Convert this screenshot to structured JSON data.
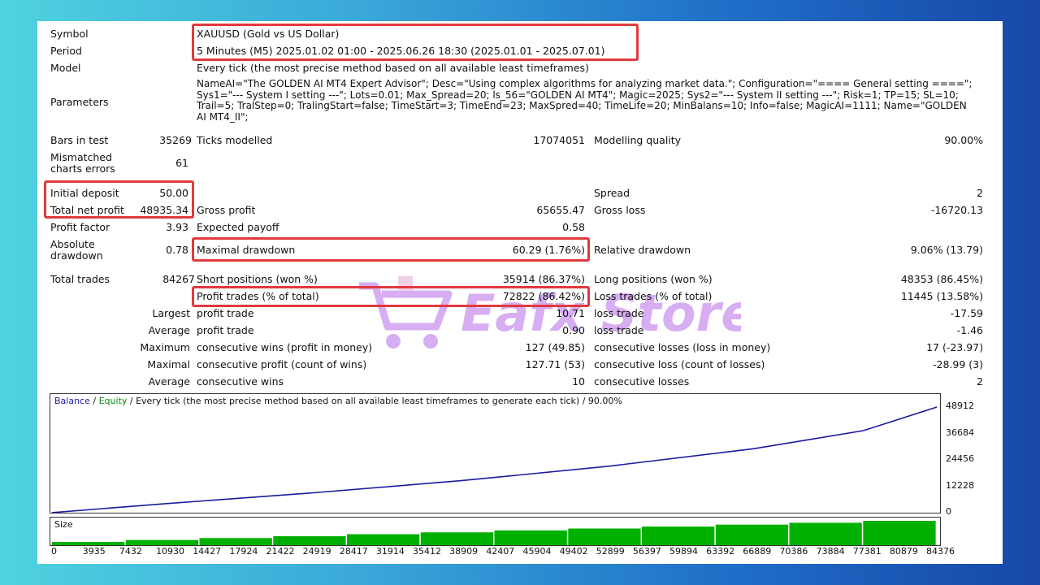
{
  "report": {
    "symbol_label": "Symbol",
    "symbol_value": "XAUUSD (Gold vs US Dollar)",
    "period_label": "Period",
    "period_value": "5 Minutes (M5) 2025.01.02 01:00 - 2025.06.26 18:30 (2025.01.01 - 2025.07.01)",
    "model_label": "Model",
    "model_value": "Every tick (the most precise method based on all available least timeframes)",
    "parameters_label": "Parameters",
    "parameters_value": "NameAI=\"The GOLDEN AI MT4 Expert Advisor\"; Desc=\"Using complex algorithms for analyzing market data.\"; Configuration=\"==== General setting ====\"; Sys1=\"--- System I setting ---\"; Lots=0.01; Max_Spread=20; ls_56=\"GOLDEN AI MT4\"; Magic=2025; Sys2=\"--- System II setting ---\"; Risk=1; TP=15; SL=10; Trail=5; TralStep=0; TralingStart=false; TimeStart=3; TimeEnd=23; MaxSpred=40; TimeLife=20; MinBalans=10; Info=false; MagicAI=1111; Name=\"GOLDEN AI MT4_II\";"
  },
  "stats": {
    "bars_label": "Bars in test",
    "bars_value": "35269",
    "ticks_label": "Ticks modelled",
    "ticks_value": "17074051",
    "quality_label": "Modelling quality",
    "quality_value": "90.00%",
    "mismatch_label": "Mismatched charts errors",
    "mismatch_value": "61",
    "initial_label": "Initial deposit",
    "initial_value": "50.00",
    "spread_label": "Spread",
    "spread_value": "2",
    "net_label": "Total net profit",
    "net_value": "48935.34",
    "gross_profit_label": "Gross profit",
    "gross_profit_value": "65655.47",
    "gross_loss_label": "Gross loss",
    "gross_loss_value": "-16720.13",
    "pf_label": "Profit factor",
    "pf_value": "3.93",
    "ep_label": "Expected payoff",
    "ep_value": "0.58",
    "abs_dd_label": "Absolute drawdown",
    "abs_dd_value": "0.78",
    "max_dd_label": "Maximal drawdown",
    "max_dd_value": "60.29 (1.76%)",
    "rel_dd_label": "Relative drawdown",
    "rel_dd_value": "9.06% (13.79)",
    "trades_label": "Total trades",
    "trades_value": "84267",
    "short_label": "Short positions (won %)",
    "short_value": "35914 (86.37%)",
    "long_label": "Long positions (won %)",
    "long_value": "48353 (86.45%)",
    "profit_trades_label": "Profit trades (% of total)",
    "profit_trades_value": "72822 (86.42%)",
    "loss_trades_label": "Loss trades (% of total)",
    "loss_trades_value": "11445 (13.58%)",
    "largest_label": "Largest",
    "largest_profit_label": "profit trade",
    "largest_profit_value": "10.71",
    "largest_loss_label": "loss trade",
    "largest_loss_value": "-17.59",
    "average_label": "Average",
    "average_profit_label": "profit trade",
    "average_profit_value": "0.90",
    "average_loss_label": "loss trade",
    "average_loss_value": "-1.46",
    "maximum_label": "Maximum",
    "max_wins_label": "consecutive wins (profit in money)",
    "max_wins_value": "127 (49.85)",
    "max_losses_label": "consecutive losses (loss in money)",
    "max_losses_value": "17 (-23.97)",
    "maximal_label": "Maximal",
    "maximal_profit_label": "consecutive profit (count of wins)",
    "maximal_profit_value": "127.71 (53)",
    "maximal_loss_label": "consecutive loss (count of losses)",
    "maximal_loss_value": "-28.99 (3)",
    "avg2_label": "Average",
    "avg_wins_label": "consecutive wins",
    "avg_wins_value": "10",
    "avg_losses_label": "consecutive losses",
    "avg_losses_value": "2"
  },
  "watermark": {
    "text": "Eafx Store",
    "text_color": "#b86de6"
  },
  "colors": {
    "highlight": "#e03a3e",
    "balance": "#1a1a9e",
    "equity": "#0a8a0a",
    "size": "#00b000"
  },
  "chart": {
    "legend_balance": "Balance",
    "legend_sep1": " / ",
    "legend_equity": "Equity",
    "legend_rest": " / Every tick (the most precise method based on all available least timeframes to generate each tick) / 90.00%",
    "size_label": "Size"
  },
  "chart_data": {
    "type": "line",
    "series": [
      {
        "name": "Balance",
        "x": [
          0,
          10930,
          24919,
          38909,
          52899,
          66889,
          77381,
          84376
        ],
        "values": [
          50,
          4200,
          9200,
          14800,
          21400,
          29600,
          38000,
          48912
        ]
      }
    ],
    "y_ticks": [
      "48912",
      "36684",
      "24456",
      "12228",
      "0"
    ],
    "x_ticks": [
      "0",
      "3935",
      "7432",
      "10930",
      "14427",
      "17924",
      "21422",
      "24919",
      "28417",
      "31914",
      "35412",
      "38909",
      "42407",
      "45904",
      "49402",
      "52899",
      "56397",
      "59894",
      "63392",
      "66889",
      "70386",
      "73884",
      "77381",
      "80879",
      "84376"
    ],
    "ylim": [
      0,
      48912
    ],
    "xlim": [
      0,
      84376
    ]
  }
}
